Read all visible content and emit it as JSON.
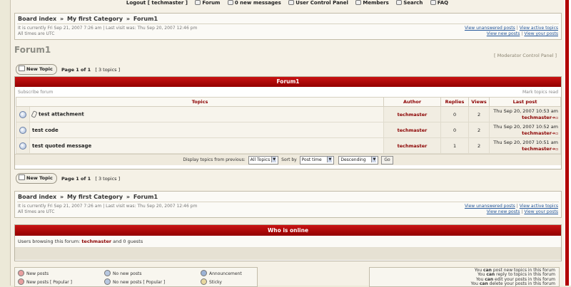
{
  "topnav": {
    "items": [
      "Logout [ techmaster ]",
      "Forum",
      "0 new messages",
      "User Control Panel",
      "Members",
      "Search",
      "FAQ"
    ]
  },
  "breadcrumb": [
    "Board index",
    "My first Category",
    "Forum1"
  ],
  "breadcrumb_sep": "»",
  "time_info": {
    "current": "It is currently Fri Sep 21, 2007 7:26 am | Last visit was: Thu Sep 20, 2007 12:46 pm",
    "timezone": "All times are UTC"
  },
  "quick_links": {
    "unanswered": "View unanswered posts",
    "active": "View active topics",
    "new_posts": "View new posts",
    "your_posts": "View your posts",
    "separator": "|"
  },
  "forum_title": "Forum1",
  "moderator_cp": "Moderator Control Panel",
  "new_topic_label": "New Topic",
  "pagination": {
    "page_text": "Page 1 of 1",
    "topics_count": "[ 3 topics ]"
  },
  "forum_table": {
    "header": "Forum1",
    "subscribe": "Subscribe forum",
    "mark_read": "Mark topics read",
    "columns": [
      "Topics",
      "Author",
      "Replies",
      "Views",
      "Last post"
    ],
    "rows": [
      {
        "title": "test attachment",
        "attachment": true,
        "author": "techmaster",
        "replies": "0",
        "views": "2",
        "last_date": "Thu Sep 20, 2007 10:53 am",
        "last_author": "techmaster"
      },
      {
        "title": "test code",
        "attachment": false,
        "author": "techmaster",
        "replies": "0",
        "views": "2",
        "last_date": "Thu Sep 20, 2007 10:52 am",
        "last_author": "techmaster"
      },
      {
        "title": "test quoted message",
        "attachment": false,
        "author": "techmaster",
        "replies": "1",
        "views": "2",
        "last_date": "Thu Sep 20, 2007 10:51 am",
        "last_author": "techmaster"
      }
    ]
  },
  "filter": {
    "display_label": "Display topics from previous:",
    "display_value": "All Topics",
    "sort_label": "Sort by",
    "sort_value": "Post time",
    "order_value": "Descending",
    "go_label": "Go"
  },
  "who_is_online": {
    "header": "Who is online",
    "prefix": "Users browsing this forum:",
    "user": "techmaster",
    "suffix": "and 0 guests"
  },
  "legend": [
    {
      "label": "New posts",
      "color": "#e8a0a0"
    },
    {
      "label": "No new posts",
      "color": "#b8c8e0"
    },
    {
      "label": "Announcement",
      "color": "#9cb3d6"
    },
    {
      "label": "New posts [ Popular ]",
      "color": "#e8a0a0"
    },
    {
      "label": "No new posts [ Popular ]",
      "color": "#b8c8e0"
    },
    {
      "label": "Sticky",
      "color": "#e8d8a0"
    }
  ],
  "permissions": [
    {
      "prefix": "You",
      "verb": "can",
      "rest": "post new topics in this forum"
    },
    {
      "prefix": "You",
      "verb": "can",
      "rest": "reply to topics in this forum"
    },
    {
      "prefix": "You",
      "verb": "can",
      "rest": "edit your posts in this forum"
    },
    {
      "prefix": "You",
      "verb": "can",
      "rest": "delete your posts in this forum"
    }
  ],
  "colors": {
    "header_red": "#b10000",
    "author_red": "#8b0000",
    "link_blue": "#225599"
  }
}
